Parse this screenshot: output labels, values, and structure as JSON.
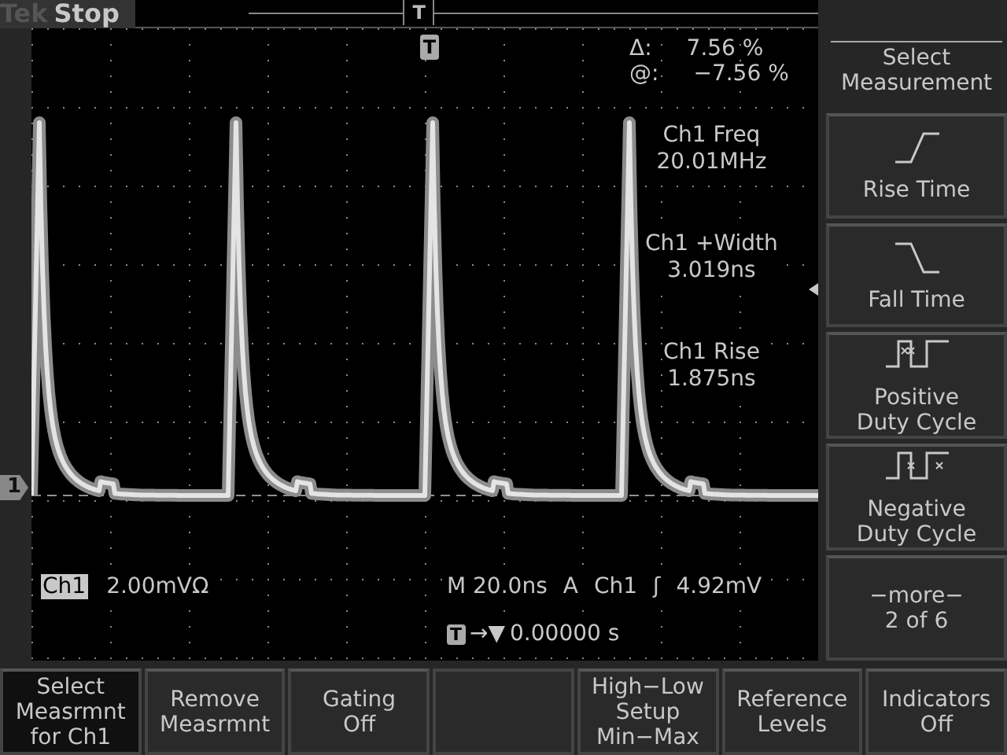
{
  "status": {
    "brand": "Tek",
    "state": "Stop",
    "trigger_marker": "T"
  },
  "display": {
    "trigger_marker": "T",
    "cursor_readout": [
      {
        "label": "Δ:",
        "value": "7.56 %"
      },
      {
        "label": "@:",
        "value": "−7.56 %"
      }
    ],
    "measurements": [
      {
        "name": "Ch1 Freq",
        "value": "20.01MHz"
      },
      {
        "name": "Ch1 +Width",
        "value": "3.019ns"
      },
      {
        "name": "Ch1 Rise",
        "value": "1.875ns"
      }
    ],
    "channel": {
      "name": "Ch1",
      "scale": "2.00mVΩ",
      "marker": "1"
    },
    "timebase": "M 20.0ns",
    "trigger": {
      "mode": "A",
      "source": "Ch1",
      "slope": "ʃ",
      "level": "4.92mV"
    },
    "position": {
      "marker": "T",
      "arrow": "→▼",
      "value": "0.00000 s"
    }
  },
  "side_menu": {
    "title": [
      "Select",
      "Measurement"
    ],
    "items": [
      {
        "kind": "rise",
        "lines": [
          "Rise Time"
        ]
      },
      {
        "kind": "fall",
        "lines": [
          "Fall Time"
        ]
      },
      {
        "kind": "pos_duty",
        "lines": [
          "Positive",
          "Duty Cycle"
        ]
      },
      {
        "kind": "neg_duty",
        "lines": [
          "Negative",
          "Duty Cycle"
        ]
      },
      {
        "kind": "more",
        "lines": [
          "−more−",
          "2 of 6"
        ]
      }
    ]
  },
  "bottom_menu": [
    {
      "kind": "button",
      "lines": [
        "Select",
        "Measrmnt",
        "for Ch1"
      ],
      "selected": true
    },
    {
      "kind": "button",
      "lines": [
        "Remove",
        "Measrmnt"
      ],
      "selected": false
    },
    {
      "kind": "button",
      "lines": [
        "Gating",
        "Off"
      ],
      "selected": false
    },
    {
      "kind": "blank"
    },
    {
      "kind": "button",
      "lines": [
        "High−Low",
        "Setup",
        "Min−Max"
      ],
      "selected": false
    },
    {
      "kind": "button",
      "lines": [
        "Reference",
        "Levels"
      ],
      "selected": false
    },
    {
      "kind": "button",
      "lines": [
        "Indicators",
        "Off"
      ],
      "selected": false
    }
  ]
}
